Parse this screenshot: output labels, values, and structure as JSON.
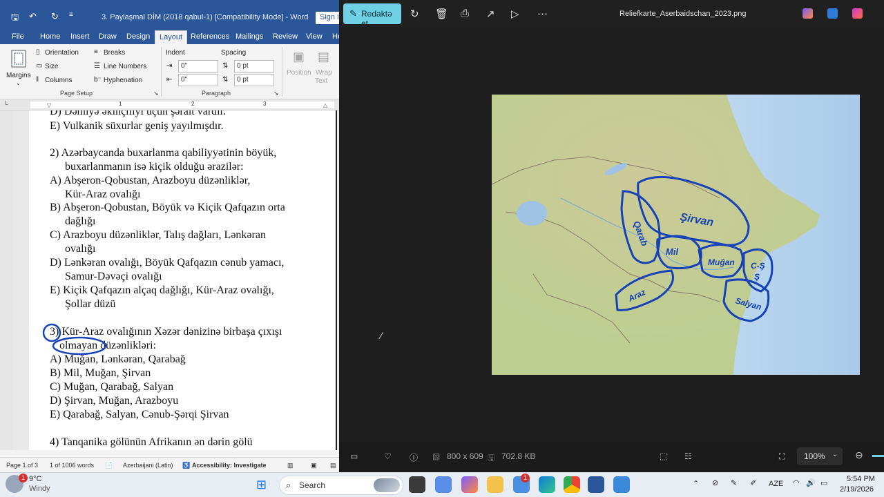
{
  "word": {
    "title": "3. Paylaşmal DİM (2018 qabul-1) [Compatibility Mode]  -  Word",
    "sign_in": "Sign i",
    "tabs": [
      "File",
      "Home",
      "Insert",
      "Draw",
      "Design",
      "Layout",
      "References",
      "Mailings",
      "Review",
      "View",
      "He"
    ],
    "active_tab": "Layout",
    "ribbon": {
      "margins": "Margins",
      "orientation": "Orientation",
      "size": "Size",
      "columns": "Columns",
      "breaks": "Breaks",
      "line_numbers": "Line Numbers",
      "hyphenation": "Hyphenation",
      "page_setup": "Page Setup",
      "indent_label": "Indent",
      "spacing_label": "Spacing",
      "indent_left": "0\"",
      "indent_right": "0\"",
      "spacing_before": "0 pt",
      "spacing_after": "0 pt",
      "paragraph": "Paragraph",
      "position": "Position",
      "wrap_text_1": "Wrap",
      "wrap_text_2": "Text"
    },
    "document_lines": [
      "D) Dəmiyə əkinçiliyi üçün şərait vardır.",
      "E) Vulkanik süxurlar geniş yayılmışdır.",
      "2) Azərbaycanda buxarlanma qabiliyyətinin böyük,",
      "buxarlanmanın isə kiçik olduğu ərazilər:",
      "A) Abşeron-Qobustan, Arazboyu düzənliklər,",
      "Kür-Araz ovalığı",
      "B) Abşeron-Qobustan, Böyük və Kiçik Qafqazın orta",
      "dağlığı",
      "C) Arazboyu düzənliklər, Talış dağları, Lənkəran",
      "ovalığı",
      "D) Lənkəran ovalığı, Böyük Qafqazın cənub yamacı,",
      "Samur-Dəvəçi ovalığı",
      "E) Kiçik Qafqazın alçaq dağlığı, Kür-Araz ovalığı,",
      "Şollar düzü",
      "3) Kür-Araz ovalığının Xəzər dənizinə birbaşa çıxışı",
      "olmayan düzənlikləri:",
      "A) Muğan, Lənkəran, Qarabağ",
      "B) Mil, Muğan, Şirvan",
      "C) Muğan, Qarabağ, Salyan",
      "D) Şirvan, Muğan, Arazboyu",
      "E) Qarabağ, Salyan, Cənub-Şərqi Şirvan",
      "4) Tanqanika gölünün Afrikanın ən dərin gölü"
    ],
    "ruler_ticks": [
      "1",
      "2",
      "3"
    ],
    "status": {
      "page": "Page 1 of 3",
      "words": "1 of 1006 words",
      "language": "Azerbaijani (Latin)",
      "accessibility": "Accessibility: Investigate"
    }
  },
  "photos": {
    "edit_button": "Redaktə et",
    "filename": "Reliefkarte_Aserbaidschan_2023.png",
    "dimensions": "800 x 609",
    "filesize": "702.8 KB",
    "zoom": "100%",
    "annotations": [
      "Qarab",
      "Şirvan",
      "Mil",
      "Muğan",
      "C-Ş",
      "Ş",
      "Araz",
      "Salyan"
    ]
  },
  "taskbar": {
    "weather_temp": "9°C",
    "weather_desc": "Windy",
    "search": "Search",
    "lang": "AZE",
    "time": "5:54 PM",
    "date": "2/19/2026"
  },
  "colors": {
    "word_blue": "#2b579a",
    "edit_accent": "#6fd0e6",
    "annotation_ink": "#1642b5"
  }
}
